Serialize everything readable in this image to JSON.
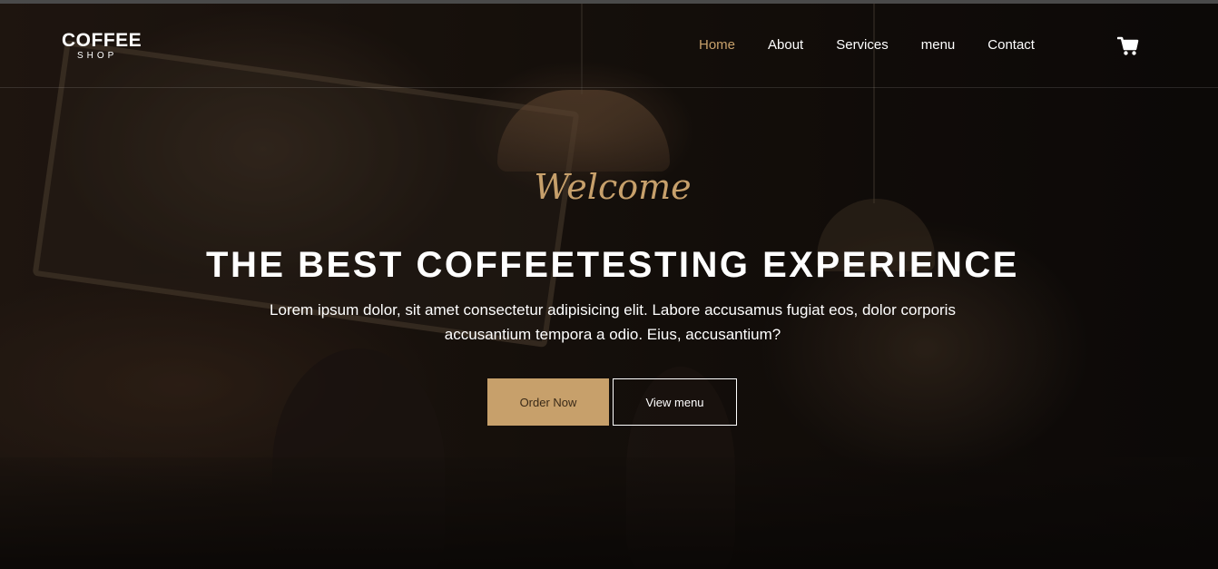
{
  "brand": {
    "name": "COFFEE",
    "sub": "SHOP"
  },
  "nav": {
    "items": [
      {
        "label": "Home",
        "active": true
      },
      {
        "label": "About",
        "active": false
      },
      {
        "label": "Services",
        "active": false
      },
      {
        "label": "menu",
        "active": false
      },
      {
        "label": "Contact",
        "active": false
      }
    ],
    "cart_icon": "cart-icon"
  },
  "hero": {
    "welcome": "Welcome",
    "headline": "THE BEST COFFEETESTING EXPERIENCE",
    "description": "Lorem ipsum dolor, sit amet consectetur adipisicing elit. Labore accusamus fugiat eos, dolor corporis accusantium tempora a odio. Eius, accusantium?",
    "order_button": "Order Now",
    "menu_button": "View menu"
  },
  "colors": {
    "accent": "#c7a06b",
    "text": "#ffffff",
    "background": "#0d0a08"
  }
}
